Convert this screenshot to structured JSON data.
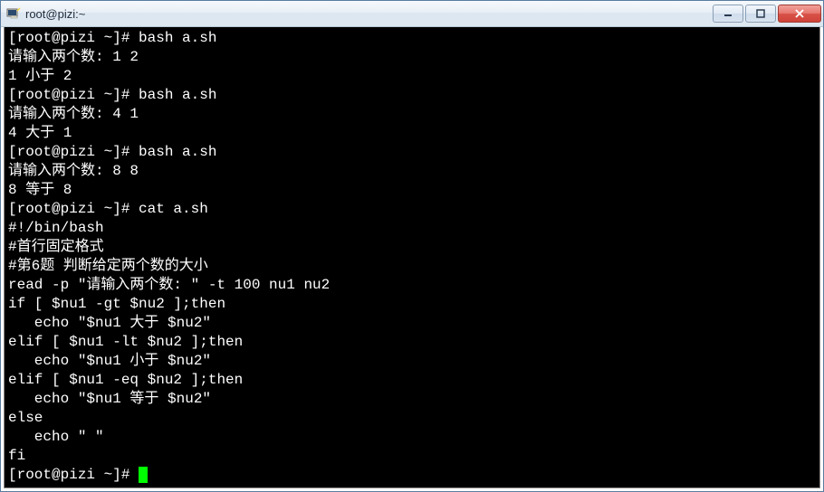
{
  "titlebar": {
    "title": "root@pizi:~"
  },
  "win_controls": {
    "min": "minimize",
    "max": "maximize",
    "close": "close"
  },
  "lines": {
    "l0a": "[root@pizi ~]#",
    "l0b": " bash a.sh",
    "l1": "请输入两个数: 1 2",
    "l2": "1 小于 2",
    "l3a": "[root@pizi ~]#",
    "l3b": " bash a.sh",
    "l4": "请输入两个数: 4 1",
    "l5": "4 大于 1",
    "l6a": "[root@pizi ~]#",
    "l6b": " bash a.sh",
    "l7": "请输入两个数: 8 8",
    "l8": "8 等于 8",
    "l9a": "[root@pizi ~]#",
    "l9b": " cat a.sh",
    "l10": "#!/bin/bash",
    "l11": "#首行固定格式",
    "l12": "#第6题 判断给定两个数的大小",
    "l13": "read -p \"请输入两个数: \" -t 100 nu1 nu2",
    "l14": "if [ $nu1 -gt $nu2 ];then",
    "l15": "   echo \"$nu1 大于 $nu2\"",
    "l16": "elif [ $nu1 -lt $nu2 ];then",
    "l17": "   echo \"$nu1 小于 $nu2\"",
    "l18": "elif [ $nu1 -eq $nu2 ];then",
    "l19": "   echo \"$nu1 等于 $nu2\"",
    "l20": "else",
    "l21": "   echo \" \"",
    "l22": "fi",
    "l23a": "[root@pizi ~]#",
    "l23b": " "
  }
}
